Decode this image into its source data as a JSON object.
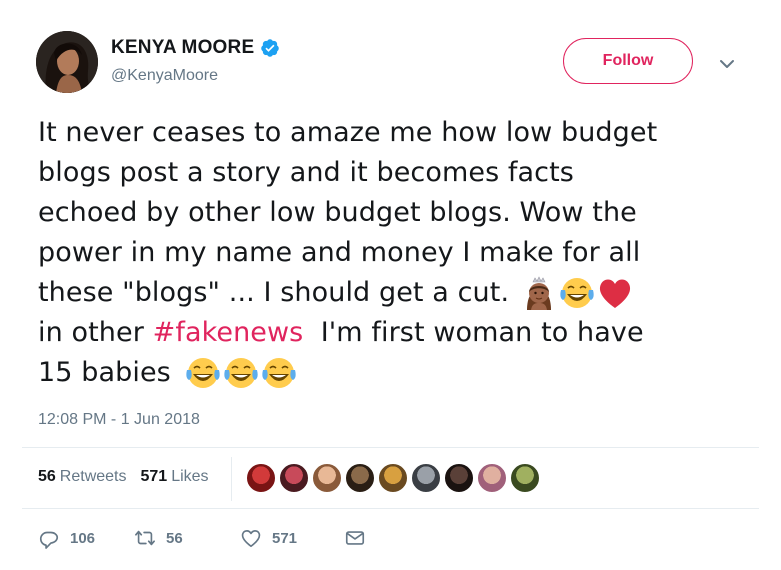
{
  "user": {
    "display_name": "KENYA MOORE",
    "handle": "@KenyaMoore",
    "verified": true,
    "avatar_icon": "profile-photo"
  },
  "header": {
    "follow_label": "Follow",
    "more_icon": "chevron-down-icon"
  },
  "tweet": {
    "lines": [
      "It never ceases to amaze me how low budget",
      "blogs post a story and it becomes facts",
      "echoed by other low budget blogs.  Wow the",
      "power in my name and money I make for all",
      "these \"blogs\" ... I should get a cut."
    ],
    "line6_prefix": "in other ",
    "hashtag": "#fakenews",
    "line6_suffix": "  I'm first woman to have",
    "line7": "15 babies",
    "emojis_line5": [
      "princess-emoji",
      "tears-of-joy-emoji",
      "red-heart-emoji"
    ],
    "emojis_line7": [
      "tears-of-joy-emoji",
      "tears-of-joy-emoji",
      "tears-of-joy-emoji"
    ]
  },
  "timestamp": "12:08 PM - 1 Jun 2018",
  "stats": {
    "retweets_count": "56",
    "retweets_label": "Retweets",
    "likes_count": "571",
    "likes_label": "Likes",
    "liker_avatar_count": 9
  },
  "actions": {
    "reply_count": "106",
    "retweet_count": "56",
    "like_count": "571"
  },
  "colors": {
    "accent": "#e0245e",
    "secondary_text": "#657786",
    "primary_text": "#14171a",
    "verified": "#1da1f2",
    "divider": "#e6ecf0"
  }
}
